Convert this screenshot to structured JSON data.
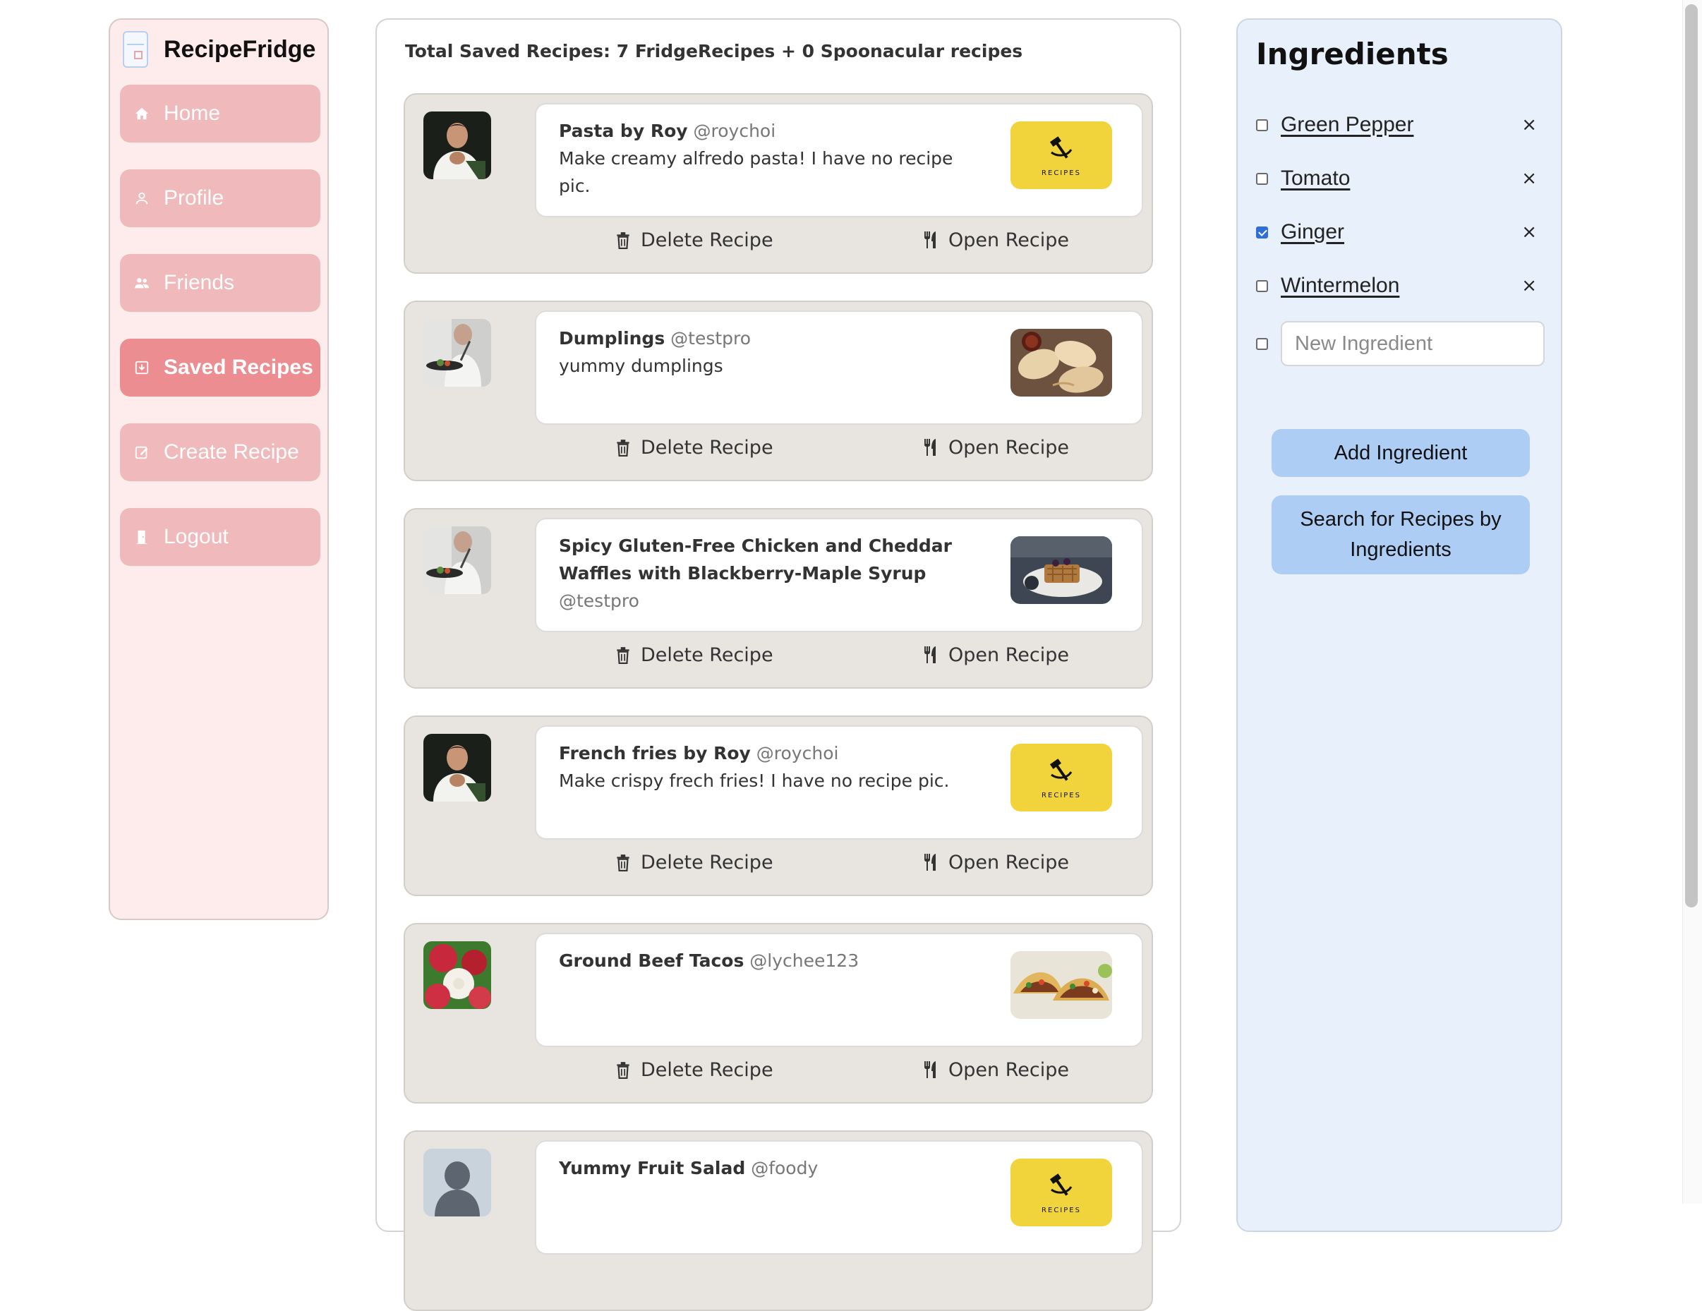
{
  "app": {
    "name": "RecipeFridge"
  },
  "sidebar": {
    "items": [
      {
        "label": "Home",
        "icon": "home-icon",
        "active": false
      },
      {
        "label": "Profile",
        "icon": "user-icon",
        "active": false
      },
      {
        "label": "Friends",
        "icon": "friends-icon",
        "active": false
      },
      {
        "label": "Saved Recipes",
        "icon": "saved-icon",
        "active": true
      },
      {
        "label": "Create Recipe",
        "icon": "edit-icon",
        "active": false
      },
      {
        "label": "Logout",
        "icon": "logout-icon",
        "active": false
      }
    ]
  },
  "main": {
    "total_label": "Total Saved Recipes: 7 FridgeRecipes + 0 Spoonacular recipes",
    "delete_label": "Delete Recipe",
    "open_label": "Open Recipe",
    "recipes": [
      {
        "title": "Pasta by Roy",
        "user": "@roychoi",
        "description": "Make creamy alfredo pasta! I have no recipe pic.",
        "avatar": "chef-roy-avatar",
        "thumb": "recipes-logo-thumb"
      },
      {
        "title": "Dumplings",
        "user": "@testpro",
        "description": "yummy dumplings",
        "avatar": "chef-cooking-avatar",
        "thumb": "dumplings-photo"
      },
      {
        "title": "Spicy Gluten-Free Chicken and Cheddar Waffles with Blackberry-Maple Syrup",
        "user": "@testpro",
        "description": "",
        "avatar": "chef-cooking-avatar",
        "thumb": "waffles-photo"
      },
      {
        "title": "French fries by Roy",
        "user": "@roychoi",
        "description": "Make crispy frech fries! I have no recipe pic.",
        "avatar": "chef-roy-avatar",
        "thumb": "recipes-logo-thumb"
      },
      {
        "title": "Ground Beef Tacos",
        "user": "@lychee123",
        "description": "",
        "avatar": "lychee-avatar",
        "thumb": "tacos-photo"
      },
      {
        "title": "Yummy Fruit Salad",
        "user": "@foody",
        "description": "",
        "avatar": "default-person-avatar",
        "thumb": "recipes-logo-thumb"
      }
    ]
  },
  "ingredients": {
    "title": "Ingredients",
    "items": [
      {
        "name": "Green Pepper",
        "checked": false
      },
      {
        "name": "Tomato",
        "checked": false
      },
      {
        "name": "Ginger",
        "checked": true
      },
      {
        "name": "Wintermelon",
        "checked": false
      }
    ],
    "remove_symbol": "×",
    "new_placeholder": "New Ingredient",
    "add_button": "Add Ingredient",
    "search_button": "Search for Recipes by Ingredients"
  },
  "colors": {
    "nav_bg": "#f0b9bb",
    "nav_active_bg": "#ec8e91",
    "sidebar_bg": "#fdeceb",
    "card_bg": "#e8e5e1",
    "ingredients_bg": "#e8f0fb",
    "button_bg": "#aecdf5",
    "checkbox_checked": "#2d6fd6",
    "recipes_logo_yellow": "#f1d33b"
  }
}
